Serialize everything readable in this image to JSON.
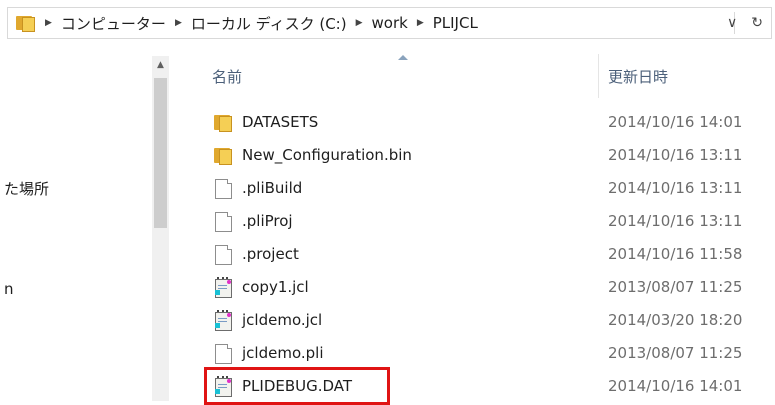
{
  "address_bar": {
    "crumbs": [
      "コンピューター",
      "ローカル ディスク (C:)",
      "work",
      "PLIJCL"
    ],
    "dropdown_glyph": "∨",
    "refresh_glyph": "↻"
  },
  "nav": {
    "items": [
      {
        "label": "た場所"
      },
      {
        "label": "n"
      }
    ]
  },
  "columns": {
    "name": "名前",
    "date_modified": "更新日時"
  },
  "files": [
    {
      "name": "DATASETS",
      "date": "2014/10/16 14:01",
      "icon": "folder-icon"
    },
    {
      "name": "New_Configuration.bin",
      "date": "2014/10/16 13:11",
      "icon": "folder-icon"
    },
    {
      "name": ".pliBuild",
      "date": "2014/10/16 13:11",
      "icon": "file-icon"
    },
    {
      "name": ".pliProj",
      "date": "2014/10/16 13:11",
      "icon": "file-icon"
    },
    {
      "name": ".project",
      "date": "2014/10/16 11:58",
      "icon": "file-icon"
    },
    {
      "name": "copy1.jcl",
      "date": "2013/08/07 11:25",
      "icon": "notepad-file-icon"
    },
    {
      "name": "jcldemo.jcl",
      "date": "2014/03/20 18:20",
      "icon": "notepad-file-icon"
    },
    {
      "name": "jcldemo.pli",
      "date": "2013/08/07 11:25",
      "icon": "file-icon"
    },
    {
      "name": "PLIDEBUG.DAT",
      "date": "2014/10/16 14:01",
      "icon": "notepad-file-icon",
      "highlighted": true
    }
  ],
  "colors": {
    "highlight_border": "#e01414",
    "header_text": "#4c607a",
    "folder": "#f5cf55"
  }
}
